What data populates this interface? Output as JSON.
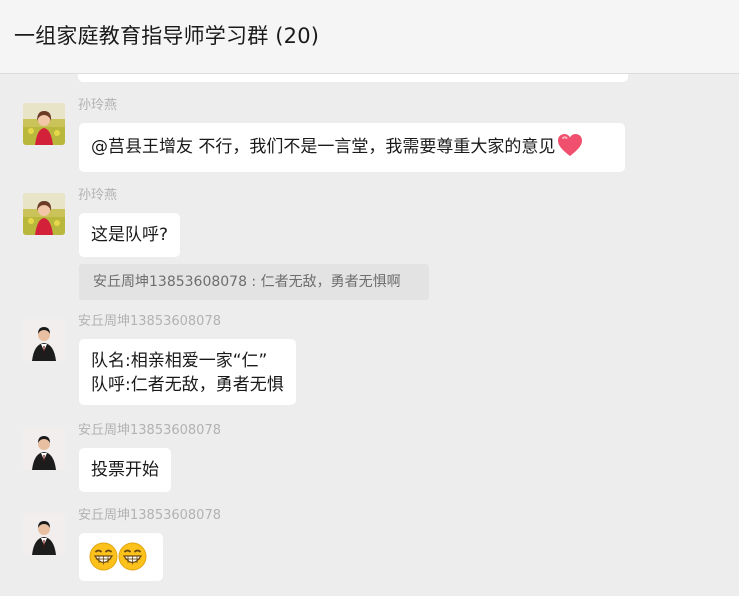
{
  "window": {
    "title": "一组家庭教育指导师学习群 (20)"
  },
  "messages": [
    {
      "sender": "孙玲燕",
      "avatar": "woman-in-red-avatar",
      "text": "@莒县王增友 不行，我们不是一言堂，我需要尊重大家的意见",
      "trailing_emoji": "red-heart"
    },
    {
      "sender": "孙玲燕",
      "avatar": "woman-in-red-avatar",
      "text": "这是队呼?",
      "quote": "安丘周坤13853608078 : 仁者无敌，勇者无惧啊"
    },
    {
      "sender": "安丘周坤13853608078",
      "avatar": "man-in-suit-avatar",
      "lines": [
        "队名:相亲相爱一家“仁”",
        "队呼:仁者无敌，勇者无惧"
      ]
    },
    {
      "sender": "安丘周坤13853608078",
      "avatar": "man-in-suit-avatar",
      "text": "投票开始"
    },
    {
      "sender": "安丘周坤13853608078",
      "avatar": "man-in-suit-avatar",
      "emojis": [
        "grinning-face-emoji",
        "grinning-face-emoji"
      ]
    }
  ],
  "colors": {
    "chat_background": "#ededed",
    "bubble": "#ffffff",
    "sender_name": "#b2b2b2",
    "quote_background": "#e3e3e3",
    "heart": "#f0506e"
  }
}
